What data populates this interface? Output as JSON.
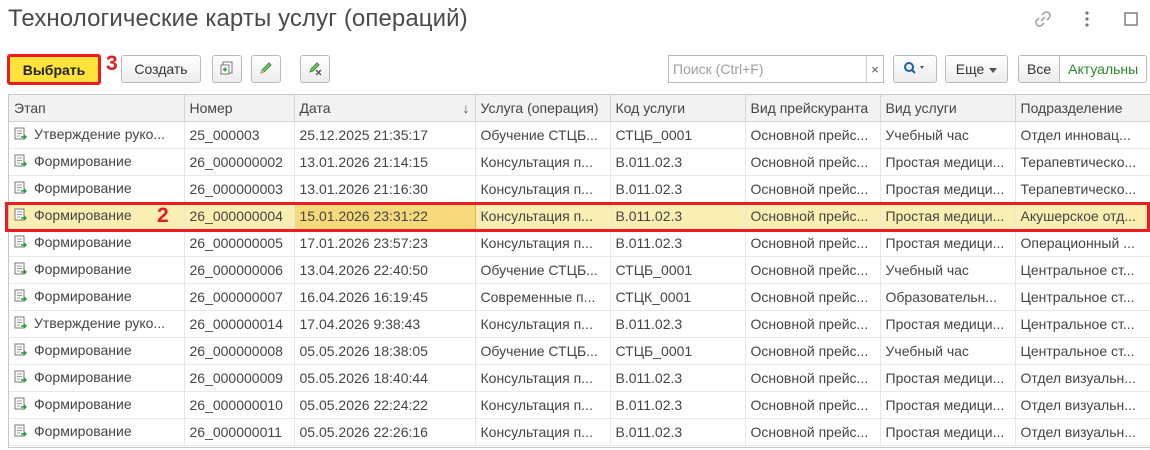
{
  "title": "Технологические карты услуг (операций)",
  "toolbar": {
    "select_label": "Выбрать",
    "create_label": "Создать",
    "search_placeholder": "Поиск (Ctrl+F)",
    "clear_glyph": "×",
    "more_label": "Еще",
    "filter_all": "Все",
    "filter_actual": "Актуальны"
  },
  "annotations": {
    "a3": "3",
    "a2": "2"
  },
  "colors": {
    "accent": "#ffe33a",
    "highlight": "#ee1b24",
    "selected_row": "#fbeeb3",
    "green_text": "#2b8a2b"
  },
  "table": {
    "columns": [
      "Этап",
      "Номер",
      "Дата",
      "Услуга (операция)",
      "Код услуги",
      "Вид прейскуранта",
      "Вид услуги",
      "Подразделение"
    ],
    "sort_glyph": "↓",
    "rows": [
      [
        "Утверждение руко...",
        "25_000003",
        "25.12.2025 21:35:17",
        "Обучение СТЦБ...",
        "СТЦБ_0001",
        "Основной прейс...",
        "Учебный час",
        "Отдел инновац..."
      ],
      [
        "Формирование",
        "26_000000002",
        "13.01.2026 21:14:15",
        "Консультация п...",
        "В.011.02.3",
        "Основной прейс...",
        "Простая медици...",
        "Терапевтическо..."
      ],
      [
        "Формирование",
        "26_000000003",
        "13.01.2026 21:16:30",
        "Консультация п...",
        "В.011.02.3",
        "Основной прейс...",
        "Простая медици...",
        "Терапевтическо..."
      ],
      [
        "Формирование",
        "26_000000004",
        "15.01.2026 23:31:22",
        "Консультация п...",
        "В.011.02.3",
        "Основной прейс...",
        "Простая медици...",
        "Акушерское отд..."
      ],
      [
        "Формирование",
        "26_000000005",
        "17.01.2026 23:57:23",
        "Консультация п...",
        "В.011.02.3",
        "Основной прейс...",
        "Простая медици...",
        "Операционный ..."
      ],
      [
        "Формирование",
        "26_000000006",
        "13.04.2026 22:40:50",
        "Обучение СТЦБ...",
        "СТЦБ_0001",
        "Основной прейс...",
        "Учебный час",
        "Центральное ст..."
      ],
      [
        "Формирование",
        "26_000000007",
        "16.04.2026 16:19:45",
        "Современные п...",
        "СТЦК_0001",
        "Основной прейс...",
        "Образовательн...",
        "Центральное ст..."
      ],
      [
        "Утверждение руко...",
        "26_000000014",
        "17.04.2026 9:38:43",
        "Консультация п...",
        "В.011.02.3",
        "Основной прейс...",
        "Простая медици...",
        "Центральное ст..."
      ],
      [
        "Формирование",
        "26_000000008",
        "05.05.2026 18:38:05",
        "Обучение СТЦБ...",
        "СТЦБ_0001",
        "Основной прейс...",
        "Учебный час",
        "Центральное ст..."
      ],
      [
        "Формирование",
        "26_000000009",
        "05.05.2026 18:40:44",
        "Консультация п...",
        "В.011.02.3",
        "Основной прейс...",
        "Простая медици...",
        "Отдел визуальн..."
      ],
      [
        "Формирование",
        "26_000000010",
        "05.05.2026 22:24:22",
        "Консультация п...",
        "В.011.02.3",
        "Основной прейс...",
        "Простая медици...",
        "Отдел визуальн..."
      ],
      [
        "Формирование",
        "26_000000011",
        "05.05.2026 22:26:16",
        "Консультация п...",
        "В.011.02.3",
        "Основной прейс...",
        "Простая медици...",
        "Отдел визуальн..."
      ]
    ],
    "selected_row": 3,
    "current_column": 2
  },
  "icons": [
    "link-icon",
    "more-vertical-icon",
    "maximize-icon",
    "add-copy-icon",
    "edit-pencil-icon",
    "mark-delete-icon",
    "search-icon",
    "document-arrow-icon"
  ]
}
